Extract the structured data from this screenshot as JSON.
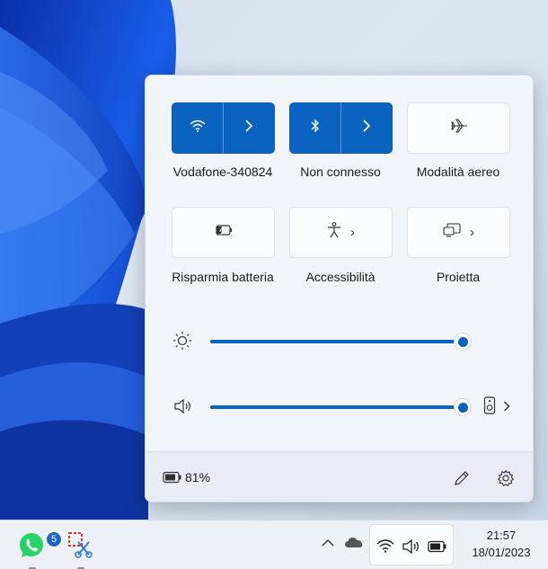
{
  "quick_settings": {
    "tiles": [
      {
        "label": "Vodafone-340824",
        "icon": "wifi-icon",
        "state": "on"
      },
      {
        "label": "Non connesso",
        "icon": "bluetooth-icon",
        "state": "on"
      },
      {
        "label": "Modalità aereo",
        "icon": "airplane-icon",
        "state": "off"
      },
      {
        "label": "Risparmia batteria",
        "icon": "battery-saver-icon",
        "state": "off"
      },
      {
        "label": "Accessibilità",
        "icon": "accessibility-icon",
        "state": "off"
      },
      {
        "label": "Proietta",
        "icon": "project-icon",
        "state": "off"
      }
    ],
    "brightness_level": 1.0,
    "volume_level": 1.0,
    "battery_percent": "81%"
  },
  "taskbar": {
    "whatsapp_badge": "5",
    "clock_time": "21:57",
    "clock_date": "18/01/2023"
  },
  "colors": {
    "accent": "#0a62c1",
    "wallpaper": "#1450d6"
  }
}
